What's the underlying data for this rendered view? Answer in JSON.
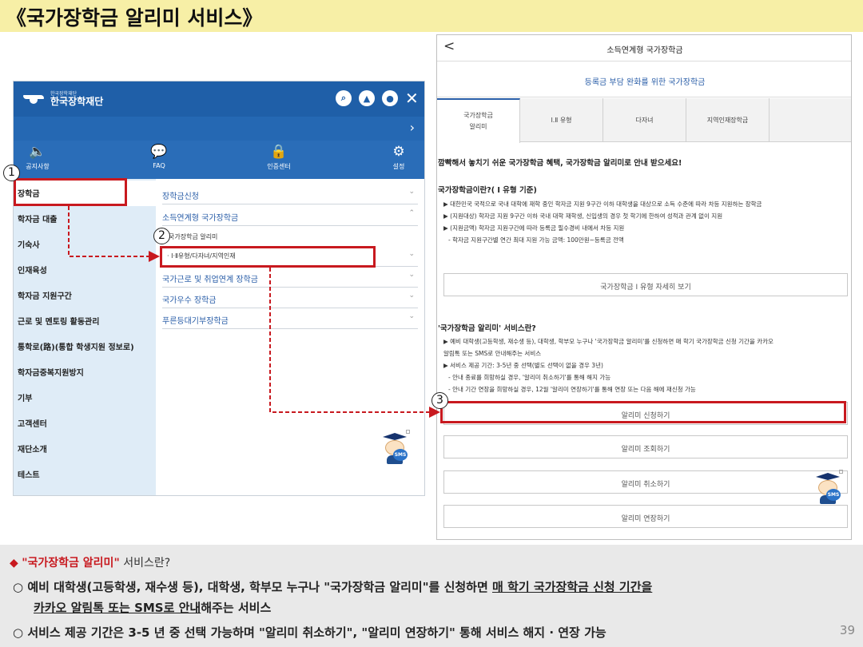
{
  "slide_title": "《국가장학금 알리미 서비스》",
  "left_app": {
    "logo_small": "한국장학재단",
    "logo_text": "한국장학재단",
    "header_icons": [
      "search-icon",
      "user-icon",
      "settings-icon",
      "close-icon"
    ],
    "tools": [
      {
        "icon": "megaphone-icon",
        "glyph": "🔈",
        "label": "공지사항"
      },
      {
        "icon": "chat-icon",
        "glyph": "💬",
        "label": "FAQ"
      },
      {
        "icon": "lock-icon",
        "glyph": "🔒",
        "label": "인증센터"
      },
      {
        "icon": "gear-icon",
        "glyph": "⚙",
        "label": "설정"
      }
    ],
    "menu": [
      "장학금",
      "학자금 대출",
      "기숙사",
      "인재육성",
      "학자금 지원구간",
      "근로 및 멘토링 활동관리",
      "통학로(路)(통합 학생지원 정보로)",
      "학자금중복지원방지",
      "기부",
      "고객센터",
      "재단소개",
      "테스트"
    ],
    "submenu": [
      {
        "label": "장학금신청",
        "arrow": "⌄"
      },
      {
        "label": "소득연계형 국가장학금",
        "arrow": "⌃"
      },
      {
        "label": "국가장학금 알리미",
        "arrow": ""
      },
      {
        "label": "· Ⅰ·Ⅱ유형/다자녀/지역인재",
        "arrow": "⌄"
      },
      {
        "label": "국가근로 및 취업연계 장학금",
        "arrow": "⌄"
      },
      {
        "label": "국가우수 장학금",
        "arrow": "⌄"
      },
      {
        "label": "푸른등대기부장학금",
        "arrow": "⌄"
      }
    ],
    "mascot_label": "SMS"
  },
  "right_app": {
    "back": "<",
    "title": "소득연계형 국가장학금",
    "banner": "등록금 부담 완화를 위한 국가장학금",
    "tabs": [
      "국가장학금\n알리미",
      "Ⅰ.Ⅱ 유형",
      "다자녀",
      "지역인재장학금"
    ],
    "intro": "깜빡해서 놓치기 쉬운 국가장학금 혜택, 국가장학금 알리미로 안내 받으세요!",
    "section1_title": "국가장학금이란?( Ⅰ 유형 기준)",
    "section1_lines": [
      "▶ 대한민국 국적으로 국내 대학에 재학 중인 학자금 지원 9구간 이하 대학생을 대상으로 소득 수준에 따라 차등 지원하는 장학금",
      "▶ (지원대상) 학자금 지원 9구간 이하 국내 대학 재학생, 신입생의 경우 첫 학기에 한하여 성적과 관계 없이 지원",
      "▶ (지원금액) 학자금 지원구간에 따라 등록금 필수경비 내에서 차등 지원"
    ],
    "section1_sub": "-  학자금 지원구간별 연간 최대 지원 가능 금액: 100만원~등록금 전액",
    "detail_button": "국가장학금 Ⅰ 유형 자세히 보기",
    "section2_title": "'국가장학금 알리미' 서비스란?",
    "section2_lines": [
      "▶ 예비 대학생(고등학생, 재수생 등), 대학생, 학부모 누구나 '국가장학금 알리미'를 신청하면 매 학기 국가장학금 신청 기간을 카카오",
      "   알림톡 또는 SMS로 안내해주는 서비스",
      "▶ 서비스 제공 기간: 3-5년 중 선택(별도 선택이 없을 경우 3년)"
    ],
    "section2_subs": [
      "-  안내 종료를 희망하실 경우, '알리미 취소하기'를 통해 해지 가능",
      "-  안내 기간 연장을 희망하실 경우, 12월 '알리미 연장하기'를 통해 연장 또는 다음 해에 재신청 가능"
    ],
    "buttons": [
      "알리미 신청하기",
      "알리미 조회하기",
      "알리미 취소하기",
      "알리미 연장하기"
    ],
    "mascot_label": "SMS"
  },
  "callouts": [
    "1",
    "2",
    "3"
  ],
  "bottom": {
    "diamond": "◆",
    "heading_red": "\"국가장학금 알리미\"",
    "heading_rest": " 서비스란?",
    "b1_bullet": "○",
    "b1_a": "예비 대학생(고등학생, 재수생 등), 대학생, 학부모 누구나 \"국가장학금 알리미\"를 신청하면 ",
    "b1_u1": "매 학기 국가장학금 신청 기간을",
    "b1_u2": "카카오 알림톡 또는 SMS로 안내",
    "b1_c": "해주는 서비스",
    "b2_bullet": "○",
    "b2": "서비스 제공 기간은 3-5 년 중 선택 가능하며 \"알리미 취소하기\", \"알리미 연장하기\" 통해 서비스 해지 · 연장 가능",
    "page_number": "39"
  },
  "colors": {
    "highlight": "#c8191f",
    "brand_blue": "#1f5fa8",
    "title_bg": "#f7efa6",
    "footer_bg": "#e9e9e9"
  }
}
